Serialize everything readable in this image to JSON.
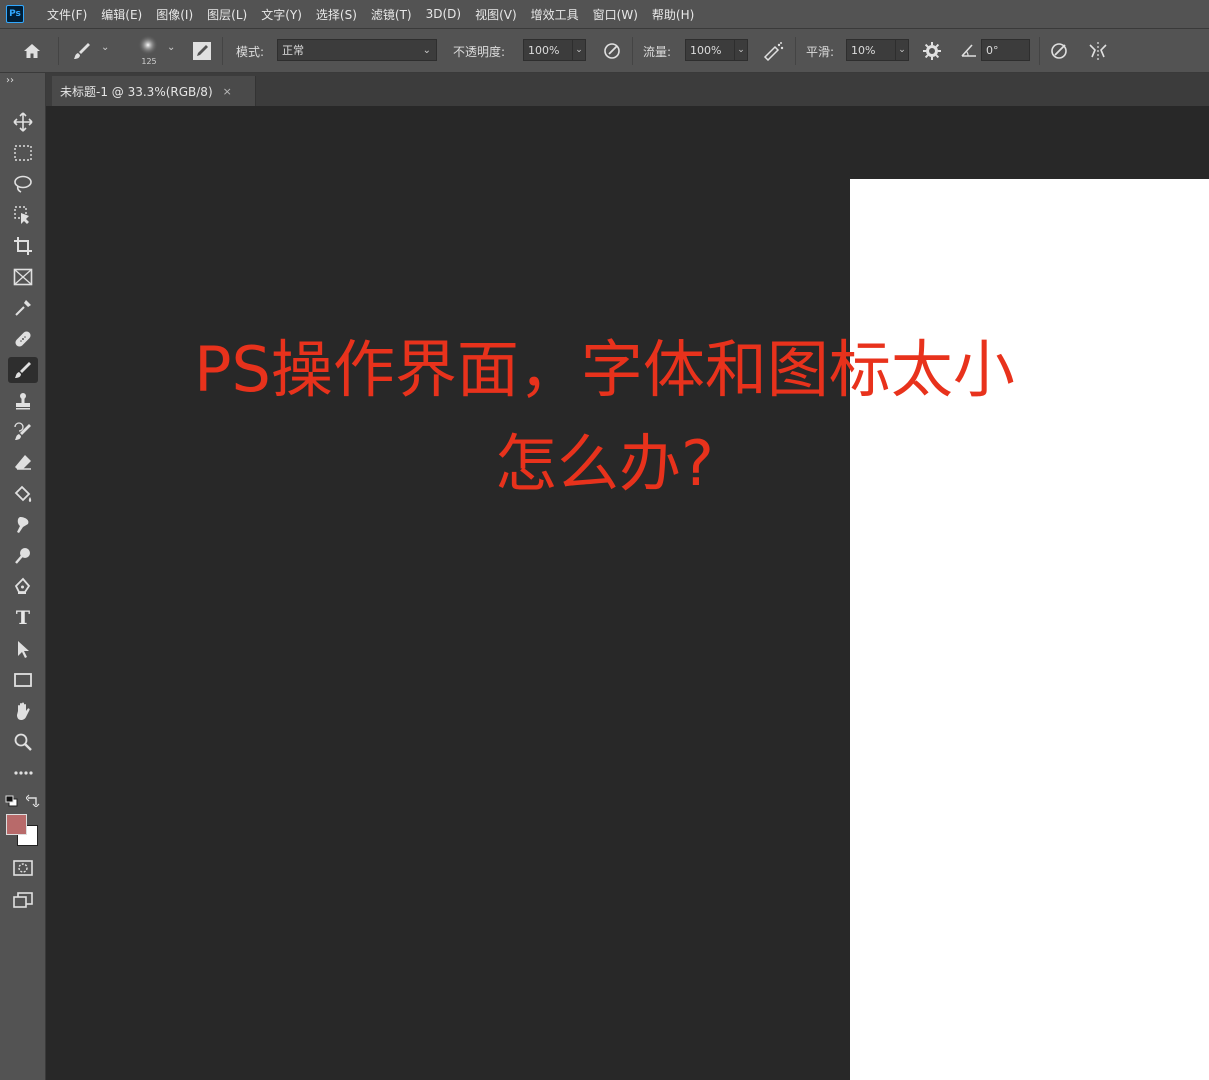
{
  "app": {
    "logo_text": "Ps"
  },
  "menu": [
    "文件(F)",
    "编辑(E)",
    "图像(I)",
    "图层(L)",
    "文字(Y)",
    "选择(S)",
    "滤镜(T)",
    "3D(D)",
    "视图(V)",
    "增效工具",
    "窗口(W)",
    "帮助(H)"
  ],
  "options": {
    "brush_size": "125",
    "mode_label": "模式:",
    "mode_value": "正常",
    "opacity_label": "不透明度:",
    "opacity_value": "100%",
    "flow_label": "流量:",
    "flow_value": "100%",
    "smoothing_label": "平滑:",
    "smoothing_value": "10%",
    "angle_value": "0°"
  },
  "document": {
    "tab_title": "未标题-1 @ 33.3%(RGB/8)",
    "close_glyph": "×"
  },
  "overlay": {
    "line1": "PS操作界面，字体和图标太小",
    "line2": "怎么办?"
  },
  "colors": {
    "foreground": "#b86a6a",
    "background": "#ffffff",
    "overlay_text": "#e8321c",
    "panel": "#535353",
    "workspace": "#282828"
  },
  "tools": [
    "move-tool",
    "marquee-tool",
    "lasso-tool",
    "object-select-tool",
    "crop-tool",
    "frame-tool",
    "eyedropper-tool",
    "healing-brush-tool",
    "brush-tool",
    "clone-stamp-tool",
    "history-brush-tool",
    "eraser-tool",
    "paint-bucket-tool",
    "smudge-tool",
    "dodge-tool",
    "pen-tool",
    "type-tool",
    "path-select-tool",
    "rectangle-tool",
    "hand-tool",
    "zoom-tool",
    "more-tools"
  ],
  "type_tool_glyph": "T"
}
